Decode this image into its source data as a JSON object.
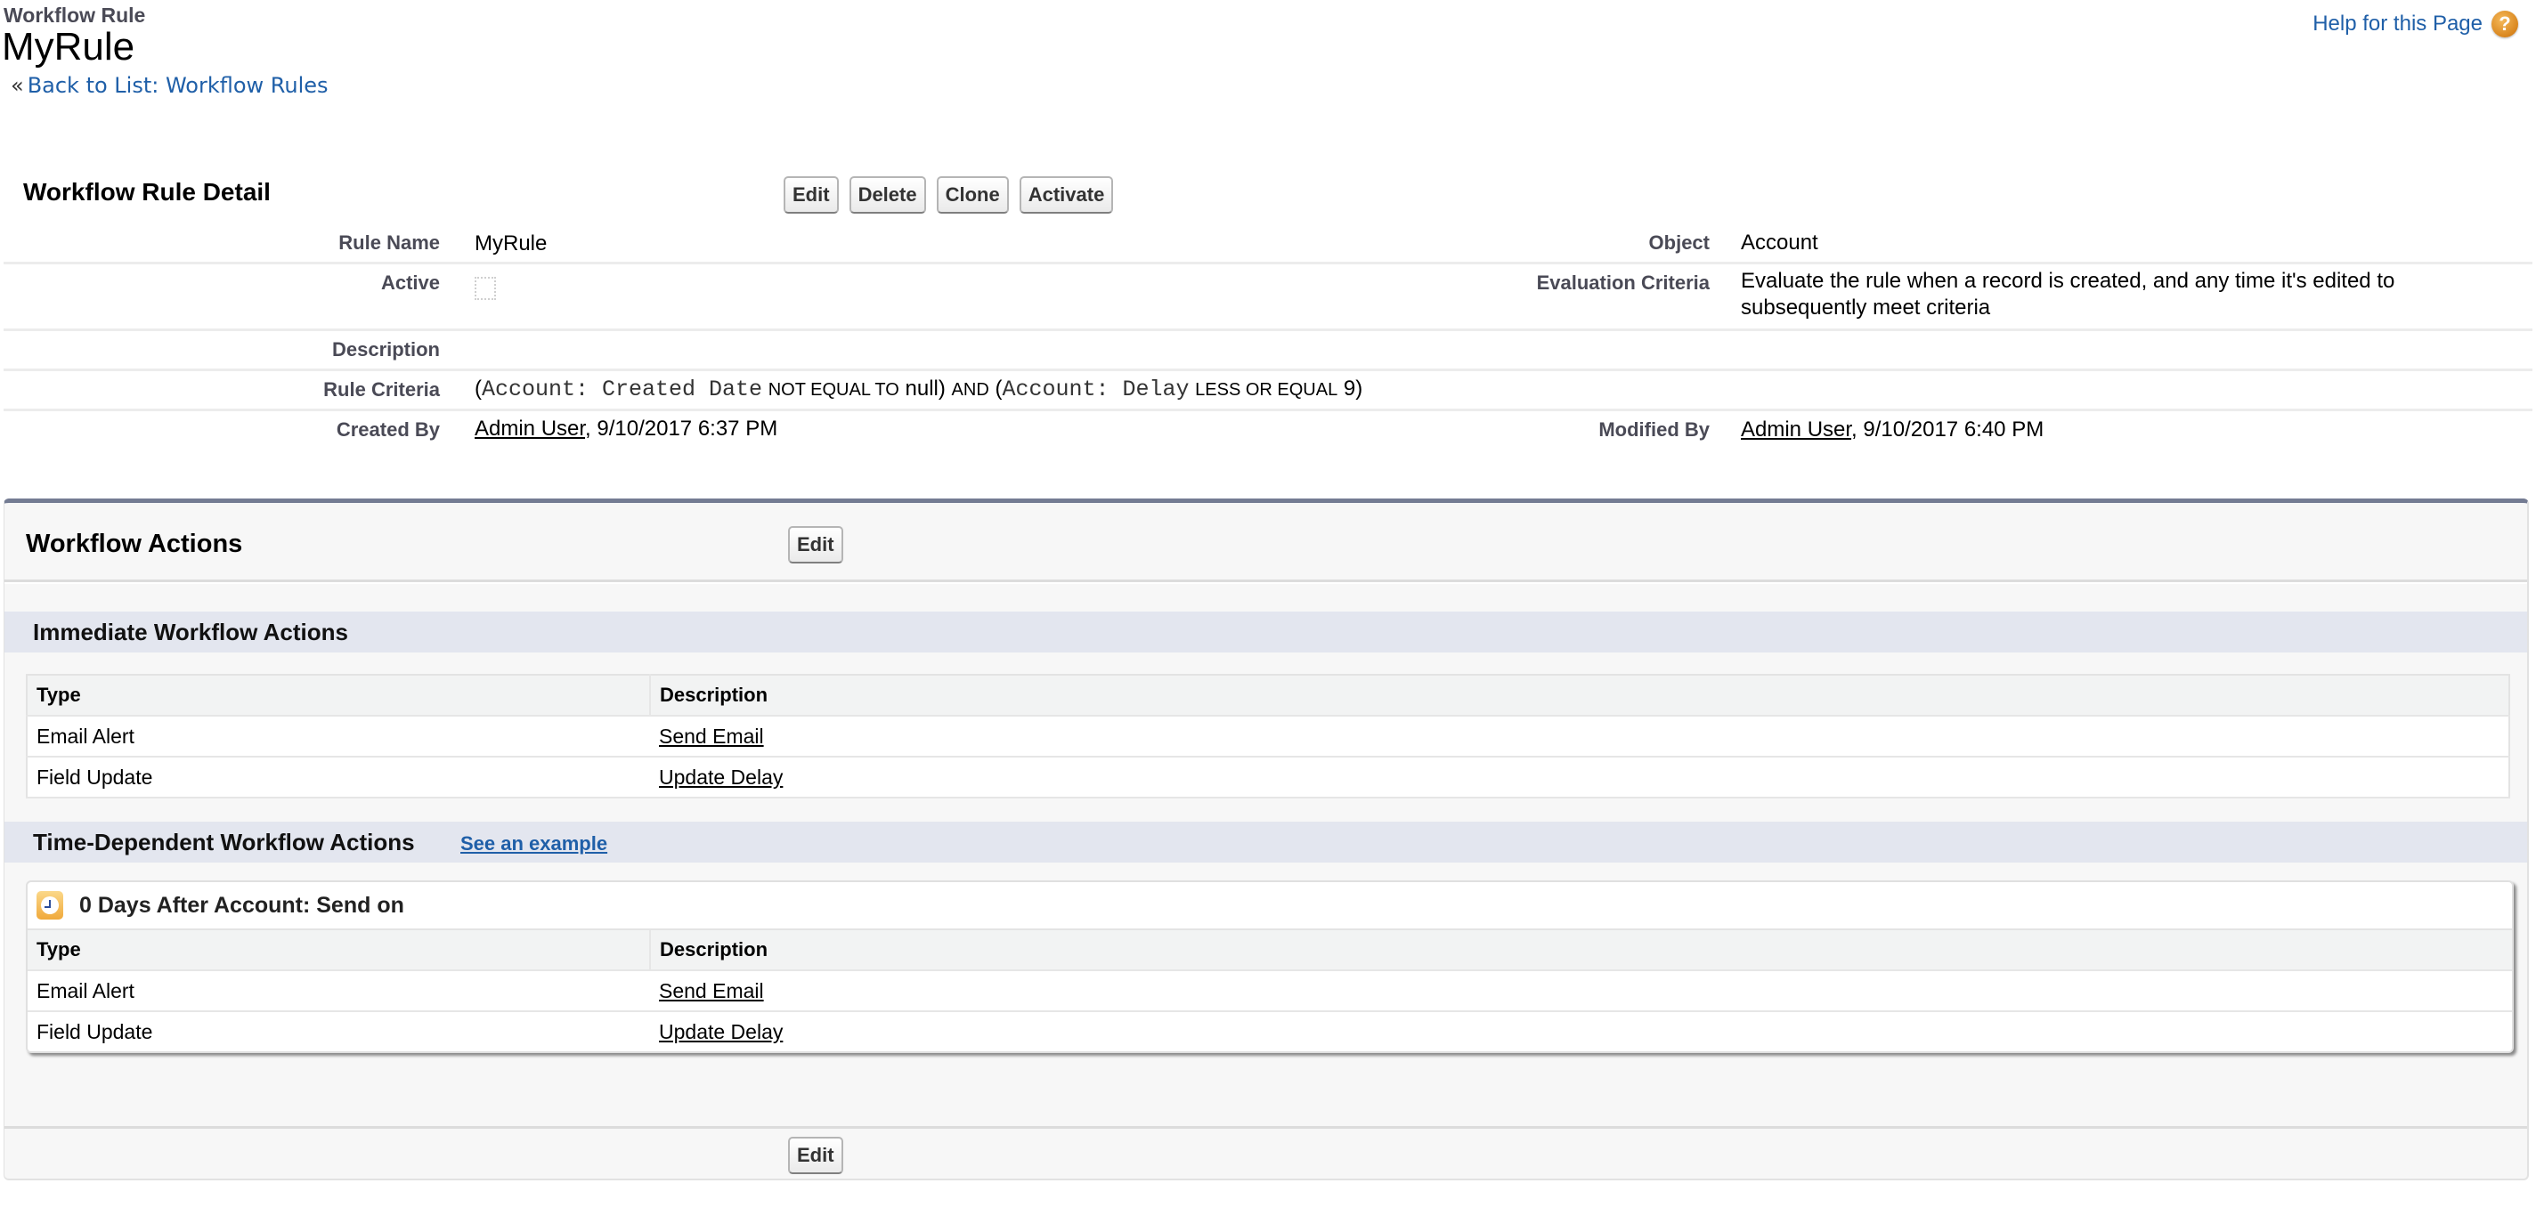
{
  "header": {
    "page_type": "Workflow Rule",
    "title": "MyRule",
    "back_prefix": "«",
    "back_link": "Back to List: Workflow Rules",
    "help_link": "Help for this Page",
    "help_icon": "?"
  },
  "detail": {
    "title": "Workflow Rule Detail",
    "buttons": {
      "edit": "Edit",
      "delete": "Delete",
      "clone": "Clone",
      "activate": "Activate"
    },
    "fields": {
      "rule_name": {
        "label": "Rule Name",
        "value": "MyRule"
      },
      "object": {
        "label": "Object",
        "value": "Account"
      },
      "active": {
        "label": "Active",
        "checked": false
      },
      "evaluation_criteria": {
        "label": "Evaluation Criteria",
        "value": "Evaluate the rule when a record is created, and any time it's edited to subsequently meet criteria"
      },
      "description": {
        "label": "Description",
        "value": ""
      },
      "rule_criteria": {
        "label": "Rule Criteria",
        "parts": {
          "open1": "(",
          "field1": "Account: Created Date",
          "op1": "NOT EQUAL TO",
          "val1": "null)",
          "and": "AND",
          "open2": "(",
          "field2": "Account: Delay",
          "op2": "LESS OR EQUAL",
          "val2": "9)"
        }
      },
      "created_by": {
        "label": "Created By",
        "user": "Admin User",
        "date": ", 9/10/2017 6:37 PM"
      },
      "modified_by": {
        "label": "Modified By",
        "user": "Admin User",
        "date": ", 9/10/2017 6:40 PM"
      }
    }
  },
  "actions": {
    "title": "Workflow Actions",
    "edit_label": "Edit",
    "immediate": {
      "title": "Immediate Workflow Actions",
      "columns": [
        "Type",
        "Description"
      ],
      "rows": [
        {
          "type": "Email Alert",
          "description": "Send Email"
        },
        {
          "type": "Field Update",
          "description": "Update Delay"
        }
      ]
    },
    "time_dependent": {
      "title": "Time-Dependent Workflow Actions",
      "see_example": "See an example",
      "trigger_title": "0 Days After Account: Send on",
      "columns": [
        "Type",
        "Description"
      ],
      "rows": [
        {
          "type": "Email Alert",
          "description": "Send Email"
        },
        {
          "type": "Field Update",
          "description": "Update Delay"
        }
      ]
    }
  }
}
